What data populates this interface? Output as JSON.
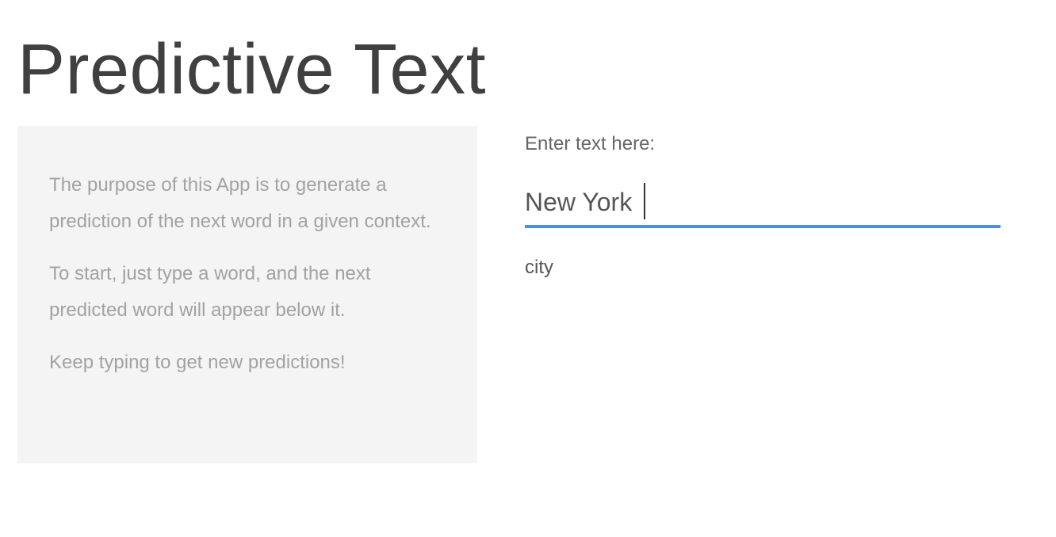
{
  "header": {
    "title": "Predictive Text"
  },
  "sidebar": {
    "paragraphs": [
      "The purpose of this App is to generate a prediction of the next word in a given context.",
      "To start, just type a word, and the next predicted word will appear below it.",
      "Keep typing to get new predictions!"
    ]
  },
  "main": {
    "input_label": "Enter text here:",
    "input_value": "New York ",
    "prediction": "city",
    "accent_color": "#4a90e2"
  }
}
